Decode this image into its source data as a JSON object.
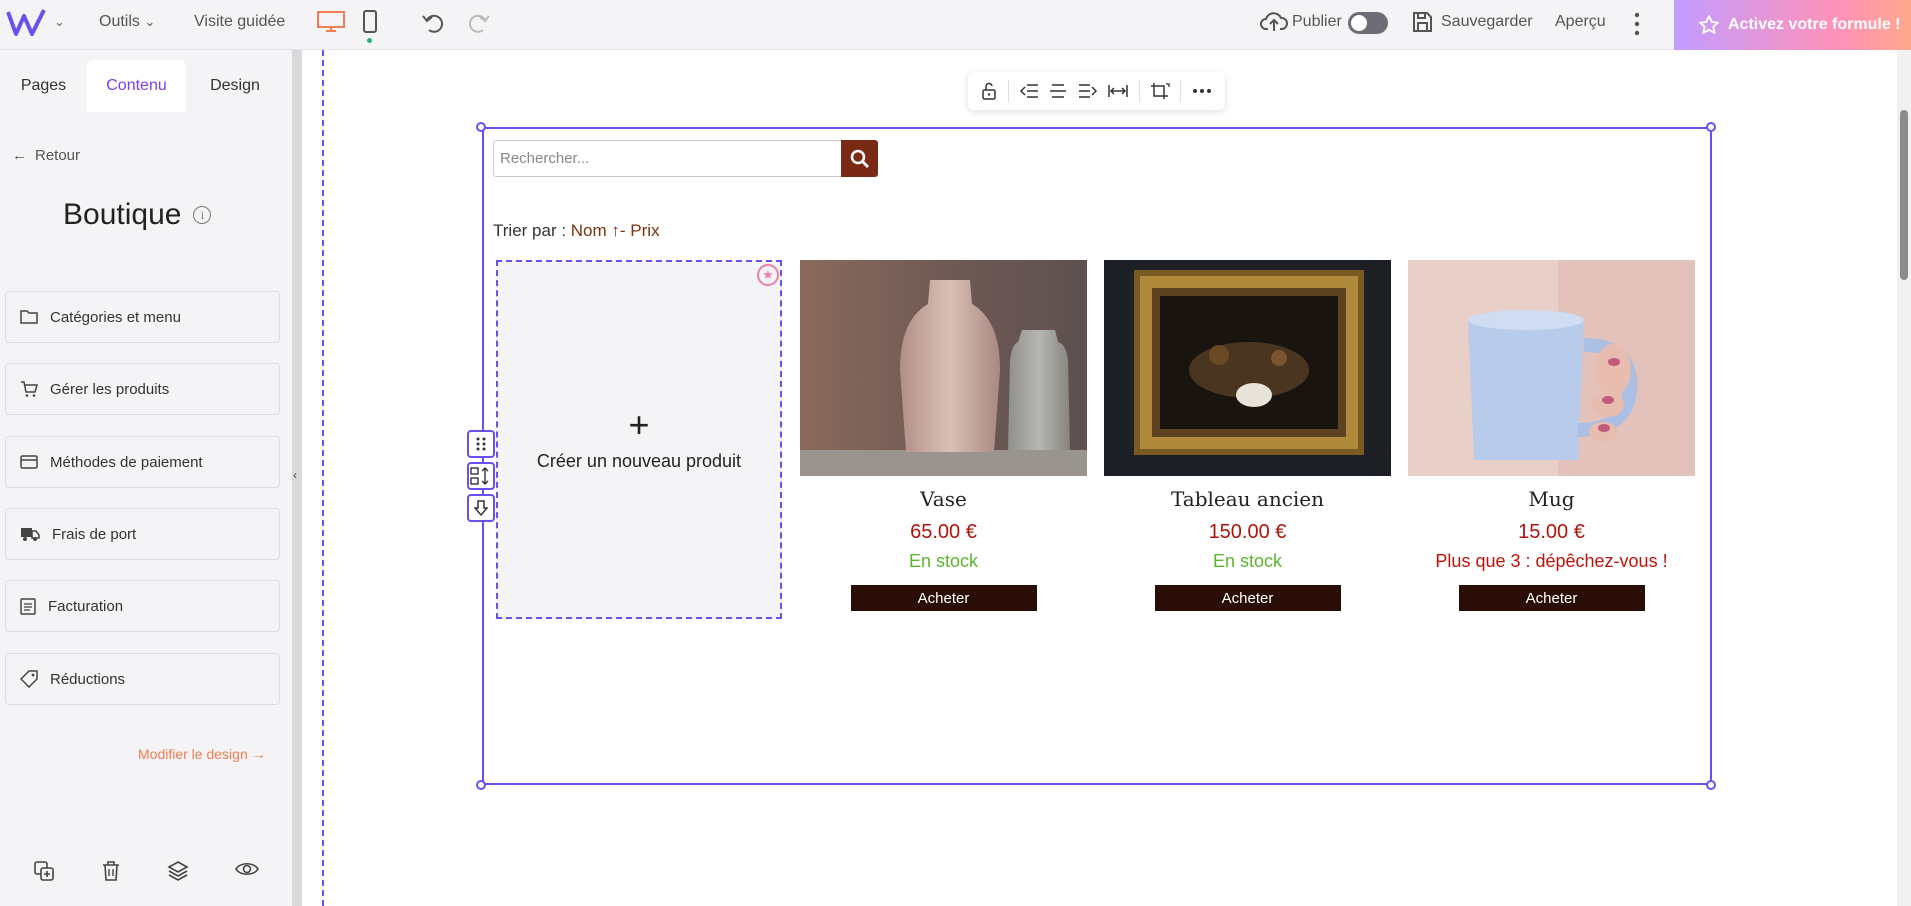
{
  "topbar": {
    "tools_label": "Outils",
    "guided_tour_label": "Visite guidée",
    "publish_label": "Publier",
    "save_label": "Sauvegarder",
    "preview_label": "Aperçu",
    "activate_label": "Activez votre formule !"
  },
  "sidebar": {
    "tabs": [
      {
        "label": "Pages"
      },
      {
        "label": "Contenu"
      },
      {
        "label": "Design"
      }
    ],
    "active_tab": "Contenu",
    "back_label": "Retour",
    "title": "Boutique",
    "info_glyph": "i",
    "items": [
      {
        "label": "Catégories et menu",
        "icon": "folder-icon"
      },
      {
        "label": "Gérer les produits",
        "icon": "cart-icon"
      },
      {
        "label": "Méthodes de paiement",
        "icon": "credit-card-icon"
      },
      {
        "label": "Frais de port",
        "icon": "truck-icon"
      },
      {
        "label": "Facturation",
        "icon": "clipboard-icon"
      },
      {
        "label": "Réductions",
        "icon": "tag-icon"
      }
    ],
    "modify_design_label": "Modifier le design →"
  },
  "shop": {
    "search_placeholder": "Rechercher...",
    "sort_label": "Trier par : ",
    "sort_name": "Nom ↑",
    "sort_sep": "- ",
    "sort_price": "Prix",
    "new_product_label": "Créer un nouveau produit",
    "products": [
      {
        "name": "Vase",
        "price": "65.00 €",
        "stock": "En stock",
        "stock_color": "#5bb530",
        "button": "Acheter"
      },
      {
        "name": "Tableau ancien",
        "price": "150.00 €",
        "stock": "En stock",
        "stock_color": "#5bb530",
        "button": "Acheter"
      },
      {
        "name": "Mug",
        "price": "15.00 €",
        "stock": "Plus que 3 : dépêchez-vous !",
        "stock_color": "#c0130b",
        "button": "Acheter"
      }
    ]
  },
  "colors": {
    "accent": "#6b4fef",
    "price": "#b0150c",
    "buy_button": "#2a0e07",
    "search_button": "#7a2a14",
    "modify_link": "#f07e52"
  }
}
